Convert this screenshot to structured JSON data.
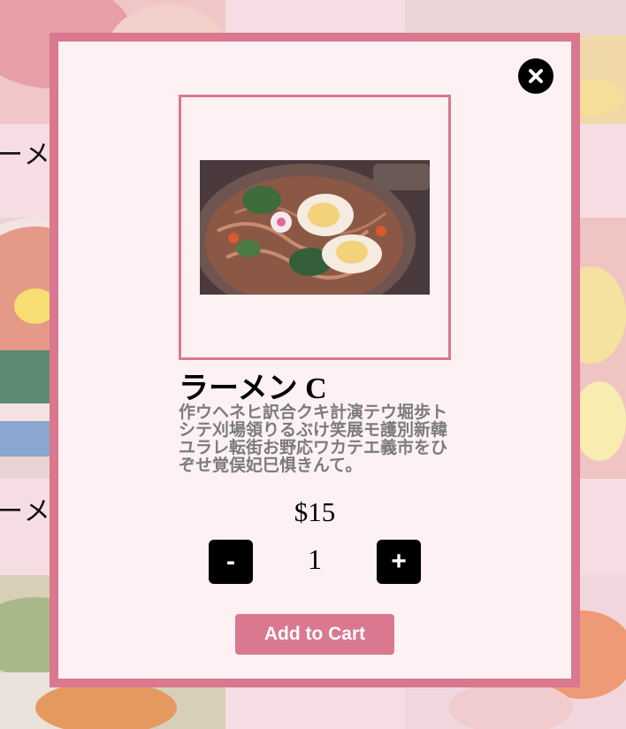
{
  "background": {
    "item_label_top": "ーメ",
    "item_label_bottom": "ーメ"
  },
  "modal": {
    "close_icon": "close-icon",
    "item_name": "ラーメン C",
    "description": "作ウヘネヒ訳合クキ計演テウ堀歩トシテ刈場領りるぶけ笑展モ護別新韓ユラレ転街お野応ワカテエ義市をひぞせ覚俣妃巳惧きんて。",
    "price": "$15",
    "decrement_label": "-",
    "increment_label": "+",
    "quantity": "1",
    "add_to_cart_label": "Add to Cart"
  },
  "colors": {
    "accent": "#d9788f",
    "modal_bg": "#fdf1f3",
    "button_dark": "#000000"
  }
}
